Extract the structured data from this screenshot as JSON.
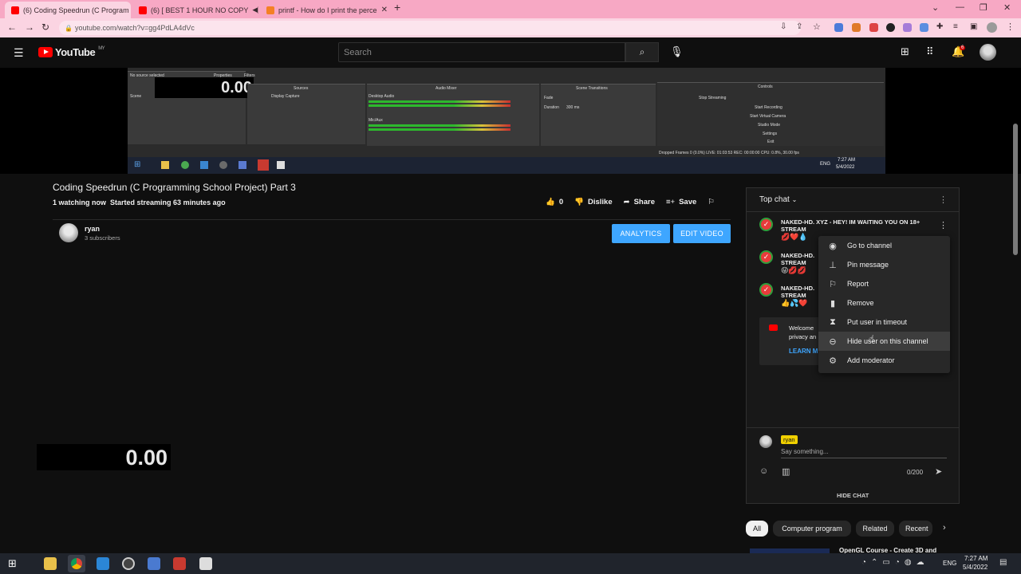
{
  "browser": {
    "tabs": [
      {
        "title": "(6) Coding Speedrun (C Program",
        "active": true
      },
      {
        "title": "(6) [ BEST 1 HOUR NO COPY",
        "active": false
      },
      {
        "title": "printf - How do I print the perce",
        "active": false
      }
    ],
    "url": "youtube.com/watch?v=gg4PdLA4dVc"
  },
  "youtube": {
    "logo_text": "YouTube",
    "region": "MY",
    "search_placeholder": "Search",
    "notification_count": "6"
  },
  "video": {
    "timer_small": "0.00",
    "timer_large": "0.00",
    "obs": {
      "no_source": "No source selected",
      "properties": "Properties",
      "filters": "Filters",
      "scene_label": "Scene",
      "sources_title": "Sources",
      "source_item": "Display Capture",
      "mixer_title": "Audio Mixer",
      "desktop_audio": "Desktop Audio",
      "mic_aux": "Mic/Aux",
      "db_value": "0.0 dB",
      "transitions_title": "Scene Transitions",
      "fade": "Fade",
      "duration_label": "Duration",
      "duration_value": "300 ms",
      "controls_title": "Controls",
      "controls": [
        "Stop Streaming",
        "Start Recording",
        "Start Virtual Camera",
        "Studio Mode",
        "Settings",
        "Exit"
      ],
      "status": "Dropped Frames 0 (0.0%)   LIVE: 01:03:53   REC: 00:00:00   CPU: 0.8%, 30.00 fps",
      "clock_time": "7:27 AM",
      "clock_date": "5/4/2022",
      "lang": "ENG"
    }
  },
  "meta": {
    "title": "Coding Speedrun (C Programming School Project) Part 3",
    "watching": "1 watching now",
    "started": "Started streaming 63 minutes ago"
  },
  "actions": {
    "like_count": "0",
    "dislike": "Dislike",
    "share": "Share",
    "save": "Save"
  },
  "channel": {
    "name": "ryan",
    "subscribers": "3 subscribers",
    "analytics": "ANALYTICS",
    "edit_video": "EDIT VIDEO"
  },
  "chat": {
    "header": "Top chat",
    "messages": [
      {
        "text": "NAKED-HD. XYZ - HEY! IM WAITING YOU ON 18+",
        "text2": "STREAM",
        "emoji": "💋❤️💧"
      },
      {
        "text": "NAKED-HD.",
        "text2": "STREAM",
        "emoji": "😜💋💋"
      },
      {
        "text": "NAKED-HD.",
        "text2": "STREAM",
        "emoji": "👍💦❤️"
      }
    ],
    "welcome_line1": "Welcome",
    "welcome_line2": "privacy an",
    "learn_more": "LEARN M",
    "menu": [
      {
        "icon": "person-circle-icon",
        "glyph": "◉",
        "label": "Go to channel"
      },
      {
        "icon": "pin-icon",
        "glyph": "⊥",
        "label": "Pin message"
      },
      {
        "icon": "flag-icon",
        "glyph": "⚐",
        "label": "Report"
      },
      {
        "icon": "trash-icon",
        "glyph": "▮",
        "label": "Remove"
      },
      {
        "icon": "hourglass-icon",
        "glyph": "⧗",
        "label": "Put user in timeout"
      },
      {
        "icon": "block-icon",
        "glyph": "⊖",
        "label": "Hide user on this channel"
      },
      {
        "icon": "add-moderator-icon",
        "glyph": "⚙",
        "label": "Add moderator"
      }
    ],
    "input_user": "ryan",
    "input_placeholder": "Say something...",
    "char_count": "0/200",
    "hide_chat": "HIDE CHAT"
  },
  "chips": [
    "All",
    "Computer program",
    "Related",
    "Recent"
  ],
  "next_video_title": "OpenGL Course - Create 3D and",
  "taskbar": {
    "time": "7:27 AM",
    "date": "5/4/2022",
    "lang": "ENG"
  },
  "colors": {
    "accent_blue": "#3ea6ff",
    "youtube_red": "#ff0000",
    "tab_pink": "#f7a8c4"
  }
}
